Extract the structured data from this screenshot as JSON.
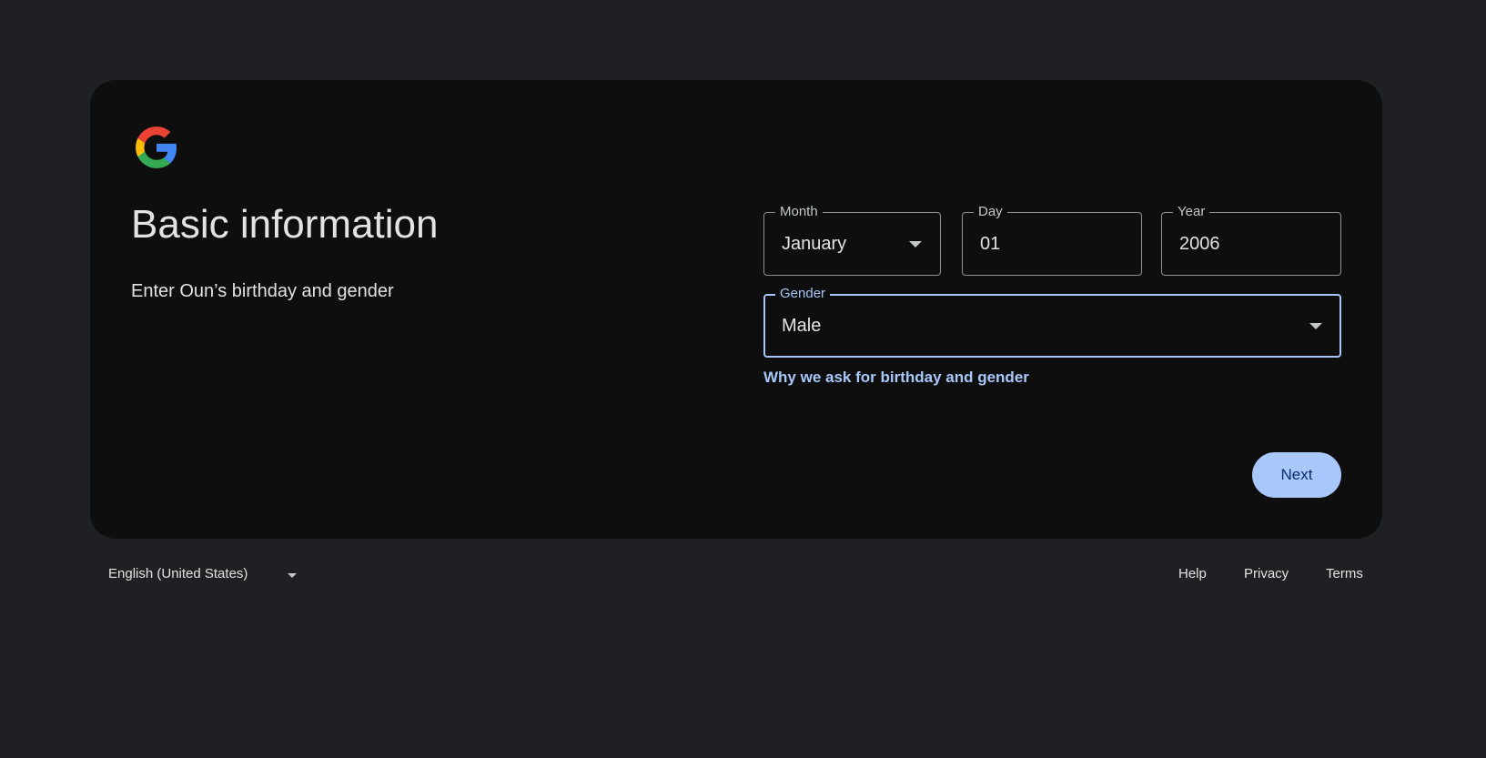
{
  "card": {
    "title": "Basic information",
    "subtitle": "Enter Oun’s birthday and gender",
    "logo_icon": "google-g-logo"
  },
  "form": {
    "month": {
      "label": "Month",
      "value": "January"
    },
    "day": {
      "label": "Day",
      "value": "01"
    },
    "year": {
      "label": "Year",
      "value": "2006"
    },
    "gender": {
      "label": "Gender",
      "value": "Male"
    },
    "why_link": "Why we ask for birthday and gender",
    "next_label": "Next"
  },
  "footer": {
    "language": "English (United States)",
    "links": [
      "Help",
      "Privacy",
      "Terms"
    ]
  },
  "colors": {
    "page_background": "#1f2023",
    "card_background": "#0e0e0e",
    "accent": "#a8c7fa",
    "button_text": "#062e6f",
    "text": "#e3e3e3"
  }
}
